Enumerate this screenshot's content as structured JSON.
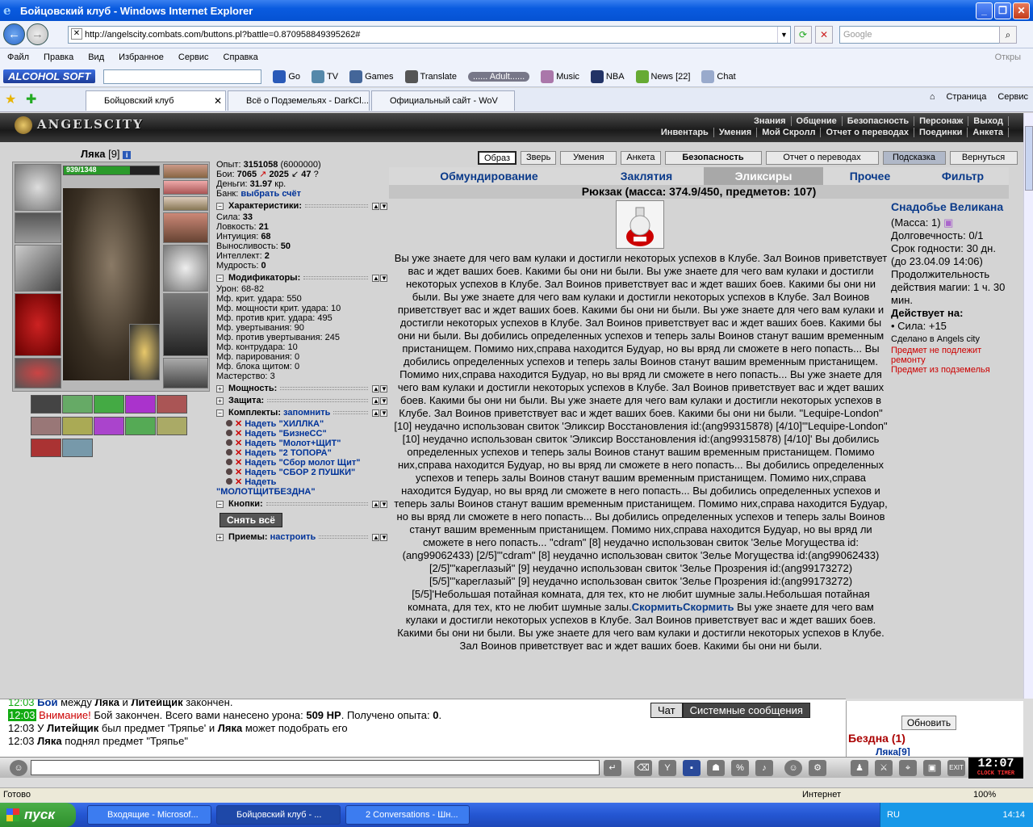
{
  "window": {
    "title": "Бойцовский клуб - Windows Internet Explorer"
  },
  "address": {
    "url": "http://angelscity.combats.com/buttons.pl?battle=0.870958849395262#",
    "search_placeholder": "Google"
  },
  "menu": [
    "Файл",
    "Правка",
    "Вид",
    "Избранное",
    "Сервис",
    "Справка"
  ],
  "menu_right": "Откры",
  "toolbar": {
    "brand": "ALCOHOL SOFT",
    "go": "Go",
    "tv": "TV",
    "games": "Games",
    "translate": "Translate",
    "adult": "...... Adult......",
    "music": "Music",
    "nba": "NBA",
    "news": "News",
    "news_count": "[22]",
    "chat": "Chat"
  },
  "tabs": [
    {
      "label": "Бойцовский клуб"
    },
    {
      "label": "Всё о Подземельях - DarkCl..."
    },
    {
      "label": "Официальный сайт - WoV"
    }
  ],
  "cmdbar": {
    "page": "Страница",
    "tools": "Сервис"
  },
  "game": {
    "logo": "ANGELSCITY",
    "top_links_1": [
      "Знания",
      "Общение",
      "Безопасность",
      "Персонаж",
      "Выход"
    ],
    "top_links_2": [
      "Инвентарь",
      "Умения",
      "Мой Скролл",
      "Отчет о переводах",
      "Поединки",
      "Анкета"
    ],
    "char": {
      "name": "Ляка",
      "level": "[9]",
      "hp": "939/1348",
      "hp_fraction": 0.697
    },
    "stats": {
      "exp_label": "Опыт:",
      "exp": "3151058",
      "exp_next": "(6000000)",
      "fights_label": "Бои:",
      "wins": "7065",
      "losses": "2025",
      "draws": "47",
      "money_label": "Деньги:",
      "money": "31.97",
      "money_unit": "кр.",
      "bank_label": "Банк:",
      "bank_link": "выбрать счёт",
      "chars_title": "Характеристики:",
      "chars": [
        {
          "k": "Сила:",
          "v": "33"
        },
        {
          "k": "Ловкость:",
          "v": "21"
        },
        {
          "k": "Интуиция:",
          "v": "68"
        },
        {
          "k": "Выносливость:",
          "v": "50"
        },
        {
          "k": "Интеллект:",
          "v": "2"
        },
        {
          "k": "Мудрость:",
          "v": "0"
        }
      ],
      "mods_title": "Модификаторы:",
      "mods": [
        {
          "k": "Урон:",
          "v": "68-82"
        },
        {
          "k": "Мф. крит. удара:",
          "v": "550"
        },
        {
          "k": "Мф. мощности крит. удара:",
          "v": "10"
        },
        {
          "k": "Мф. против крит. удара:",
          "v": "495"
        },
        {
          "k": "Мф. увертывания:",
          "v": "90"
        },
        {
          "k": "Мф. против увертывания:",
          "v": "245"
        },
        {
          "k": "Мф. контрудара:",
          "v": "10"
        },
        {
          "k": "Мф. парирования:",
          "v": "0"
        },
        {
          "k": "Мф. блока щитом:",
          "v": "0"
        },
        {
          "k": "Мастерство:",
          "v": "3"
        }
      ],
      "power_title": "Мощность:",
      "defense_title": "Защита:",
      "kits_title": "Комплекты:",
      "kits_remember": "запомнить",
      "kits": [
        "Надеть \"ХИЛЛКА\"",
        "Надеть \"БизнеСС\"",
        "Надеть \"Молот+ЩИТ\"",
        "Надеть \"2 ТОПОРА\"",
        "Надеть \"Сбор молот Щит\"",
        "Надеть \"СБОР 2 ПУШКИ\"",
        "Надеть"
      ],
      "kit_last": "\"МОЛОТЩИТБЕЗДНА\"",
      "buttons_title": "Кнопки:",
      "remove_all": "Снять всё",
      "tricks_title": "Приемы:",
      "tricks_setup": "настроить"
    },
    "top_buttons": [
      "Образ",
      "Зверь",
      "Умения",
      "Анкета",
      "Безопасность",
      "Отчет о переводах",
      "Подсказка",
      "Вернуться"
    ],
    "categories": [
      "Обмундирование",
      "Заклятия",
      "Эликсиры",
      "Прочее",
      "Фильтр"
    ],
    "backpack": "Рюкзак (масса: 374.9/450, предметов: 107)",
    "desc_1": "Вы уже знаете для чего вам кулаки и достигли некоторых успехов в Клубе. Зал Воинов приветствует вас и ждет ваших боев. Какими бы они ни были. Вы уже знаете для чего вам кулаки и достигли некоторых успехов в Клубе. Зал Воинов приветствует вас и ждет ваших боев. Какими бы они ни были. Вы уже знаете для чего вам кулаки и достигли некоторых успехов в Клубе. Зал Воинов приветствует вас и ждет ваших боев. Какими бы они ни были. Вы уже знаете для чего вам кулаки и достигли некоторых успехов в Клубе. Зал Воинов приветствует вас и ждет ваших боев. Какими бы они ни были. Вы добились определенных успехов и теперь залы Воинов станут вашим временным пристанищем. Помимо них,справа находится Будуар, но вы вряд ли сможете в него попасть... Вы добились определенных успехов и теперь залы Воинов станут вашим временным пристанищем. Помимо них,справа находится Будуар, но вы вряд ли сможете в него попасть... Вы уже знаете для чего вам кулаки и достигли некоторых успехов в Клубе. Зал Воинов приветствует вас и ждет ваших боев. Какими бы они ни были. Вы уже знаете для чего вам кулаки и достигли некоторых успехов в Клубе. Зал Воинов приветствует вас и ждет ваших боев. Какими бы они ни были. \"Lequipe-London\" [10] неудачно использован свиток 'Эликсир Восстановления id:(ang99315878) [4/10]'\"Lequipe-London\" [10] неудачно использован свиток 'Эликсир Восстановления id:(ang99315878) [4/10]' Вы добились определенных успехов и теперь залы Воинов станут вашим временным пристанищем. Помимо них,справа находится Будуар, но вы вряд ли сможете в него попасть... Вы добились определенных успехов и теперь залы Воинов станут вашим временным пристанищем. Помимо них,справа находится Будуар, но вы вряд ли сможете в него попасть... Вы добились определенных успехов и теперь залы Воинов станут вашим временным пристанищем. Помимо них,справа находится Будуар, но вы вряд ли сможете в него попасть... Вы добились определенных успехов и теперь залы Воинов станут вашим временным пристанищем. Помимо них,справа находится Будуар, но вы вряд ли сможете в него попасть... \"cdram\" [8] неудачно использован свиток 'Зелье Могущества id:(ang99062433) [2/5]'\"cdram\" [8] неудачно использован свиток 'Зелье Могущества id:(ang99062433) [2/5]'\"кареглазый\" [9] неудачно использован свиток 'Зелье Прозрения id:(ang99173272) [5/5]'\"кареглазый\" [9] неудачно использован свиток 'Зелье Прозрения id:(ang99173272) [5/5]'Небольшая потайная комната, для тех, кто не любит шумные залы.Небольшая потайная комната, для тех, кто не любит шумные залы.",
    "desc_link": "СкормитьСкормить",
    "desc_2": " Вы уже знаете для чего вам кулаки и достигли некоторых успехов в Клубе. Зал Воинов приветствует вас и ждет ваших боев. Какими бы они ни были. Вы уже знаете для чего вам кулаки и достигли некоторых успехов в Клубе. Зал Воинов приветствует вас и ждет ваших боев. Какими бы они ни были.",
    "item": {
      "name": "Снадобье Великана",
      "mass": "(Масса: 1)",
      "durability": "Долговечность: 0/1",
      "expiry": "Срок годности: 30 дн. (до 23.04.09 14:06)",
      "duration": "Продолжительность действия магии: 1 ч. 30 мин.",
      "acts": "Действует на:",
      "effect": "• Сила: +15",
      "made": "Сделано в Angels city",
      "no_repair": "Предмет не подлежит ремонту",
      "dungeon": "Предмет из подземелья"
    },
    "chat": [
      {
        "time": "12:03",
        "html_a": "Бой",
        "b": " между ",
        "c": "Ляка",
        "d": " и ",
        "e": "Литейщик",
        "f": " закончен."
      },
      {
        "time": "12:03",
        "warn": "Внимание!",
        "b": " Бой закончен. Всего вами нанесено урона: ",
        "c": "509 HP",
        "d": ". Получено опыта: ",
        "e": "0",
        "f": "."
      },
      {
        "time": "12:03",
        "a": "У ",
        "b": "Литейщик",
        "c": " был предмет 'Тряпье' и ",
        "d": "Ляка",
        "e": " может подобрать его"
      },
      {
        "time": "12:03",
        "a": "Ляка",
        "b": " поднял предмет \"Тряпье\""
      }
    ],
    "chat_tabs": [
      "Чат",
      "Системные сообщения"
    ],
    "refresh": "Обновить",
    "location": "Бездна (1)",
    "loc_user": "Ляка[9]",
    "clock": "12:07",
    "clock_label": "CLOCK TIMER"
  },
  "statusbar": {
    "ready": "Готово",
    "zone": "Интернет",
    "zoom": "100%"
  },
  "taskbar": {
    "start": "пуск",
    "tasks": [
      "Входящие - Microsof...",
      "Бойцовский клуб - ...",
      "2 Conversations - Шн..."
    ],
    "lang": "RU",
    "time": "14:14"
  }
}
